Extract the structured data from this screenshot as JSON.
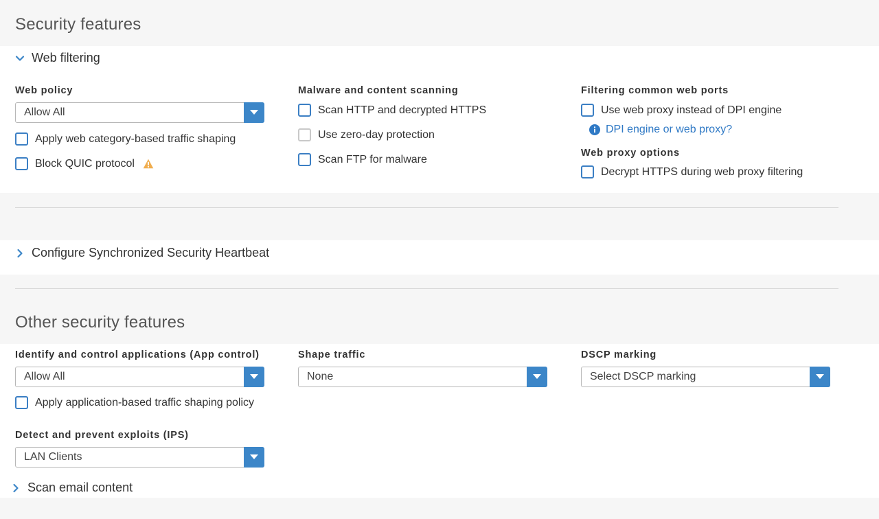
{
  "security_features": {
    "title": "Security features",
    "web_filtering": {
      "label": "Web filtering",
      "web_policy": {
        "label": "Web policy",
        "value": "Allow All"
      },
      "apply_traffic_shaping": "Apply web category-based traffic shaping",
      "block_quic": "Block QUIC protocol",
      "malware_scanning": {
        "label": "Malware and content scanning",
        "scan_http": "Scan HTTP and decrypted HTTPS",
        "zero_day": "Use zero-day protection",
        "scan_ftp": "Scan FTP for malware"
      },
      "filtering_ports": {
        "label": "Filtering common web ports",
        "use_proxy": "Use web proxy instead of DPI engine",
        "dpi_link": "DPI engine or web proxy?"
      },
      "proxy_options": {
        "label": "Web proxy options",
        "decrypt_https": "Decrypt HTTPS during web proxy filtering"
      }
    },
    "heartbeat": {
      "label": "Configure Synchronized Security Heartbeat"
    }
  },
  "other_features": {
    "title": "Other security features",
    "app_control": {
      "label": "Identify and control applications (App control)",
      "value": "Allow All",
      "apply_shaping": "Apply application-based traffic shaping policy"
    },
    "shape_traffic": {
      "label": "Shape traffic",
      "value": "None"
    },
    "dscp": {
      "label": "DSCP marking",
      "value": "Select DSCP marking"
    },
    "ips": {
      "label": "Detect and prevent exploits (IPS)",
      "value": "LAN Clients"
    },
    "scan_email": {
      "label": "Scan email content"
    }
  },
  "colors": {
    "accent": "#3c86c8",
    "checkbox_border": "#3b7fc4",
    "warning": "#f0ad4e",
    "link": "#2f79c5"
  },
  "icons": {
    "dropdown": "caret-down-icon",
    "warning": "warning-icon",
    "info": "info-icon",
    "expand": "chevron-right-icon",
    "collapse": "chevron-down-icon"
  }
}
